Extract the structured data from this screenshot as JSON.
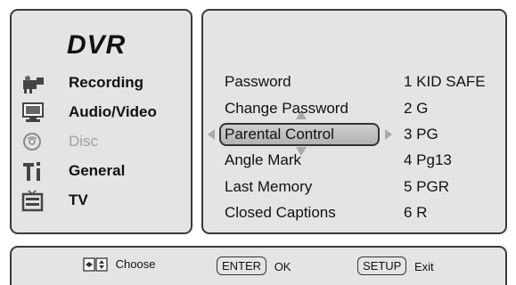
{
  "sidebar": {
    "title": "DVR",
    "items": [
      {
        "label": "Recording",
        "icon": "recording-camera-icon",
        "enabled": true
      },
      {
        "label": "Audio/Video",
        "icon": "monitor-icon",
        "enabled": true
      },
      {
        "label": "Disc",
        "icon": "disc-icon",
        "enabled": false
      },
      {
        "label": "General",
        "icon": "tools-icon",
        "enabled": true
      },
      {
        "label": "TV",
        "icon": "tv-icon",
        "enabled": true
      }
    ]
  },
  "settings": {
    "rows": [
      {
        "name": "Password",
        "value": "1 KID SAFE"
      },
      {
        "name": "Change Password",
        "value": "2 G"
      },
      {
        "name": "Parental Control",
        "value": "3 PG"
      },
      {
        "name": "Angle Mark",
        "value": "4 Pg13"
      },
      {
        "name": "Last Memory",
        "value": "5 PGR"
      },
      {
        "name": "Closed Captions",
        "value": "6 R"
      }
    ],
    "selected_row": "Parental Control"
  },
  "footer": {
    "choose_label": "Choose",
    "ok_key": "ENTER",
    "ok_label": "OK",
    "setup_key": "SETUP",
    "exit_label": "Exit"
  },
  "colors": {
    "panel_bg": "#e4e4e4",
    "border": "#3a3a3a",
    "highlight": "#bdbdbd",
    "disabled_text": "#a0a0a0"
  }
}
